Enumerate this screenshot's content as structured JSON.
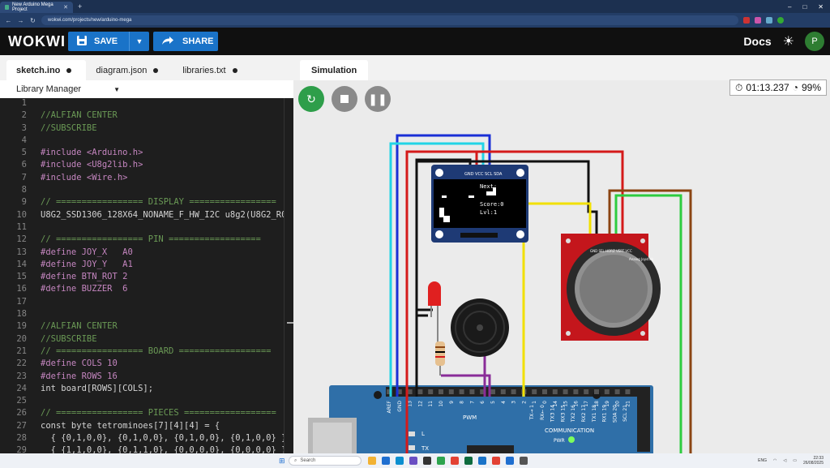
{
  "browser": {
    "tab_title": "New Arduino Mega Project",
    "url": "wokwi.com/projects/new/arduino-mega",
    "window_controls": [
      "–",
      "□",
      "✕"
    ]
  },
  "header": {
    "logo": "WOKWI",
    "save_label": "SAVE",
    "share_label": "SHARE",
    "docs_label": "Docs",
    "avatar_initial": "P",
    "accent": "#1a73c8"
  },
  "editor": {
    "tabs": [
      {
        "label": "sketch.ino"
      },
      {
        "label": "diagram.json"
      },
      {
        "label": "libraries.txt"
      }
    ],
    "library_manager_label": "Library Manager",
    "lines": [
      {
        "n": "1",
        "t": ""
      },
      {
        "n": "2",
        "t": "//ALFIAN CENTER",
        "c": "c-com"
      },
      {
        "n": "3",
        "t": "//SUBSCRIBE",
        "c": "c-com"
      },
      {
        "n": "4",
        "t": ""
      },
      {
        "n": "5",
        "t": "#include <Arduino.h>",
        "c": "c-def"
      },
      {
        "n": "6",
        "t": "#include <U8g2lib.h>",
        "c": "c-def"
      },
      {
        "n": "7",
        "t": "#include <Wire.h>",
        "c": "c-def"
      },
      {
        "n": "8",
        "t": ""
      },
      {
        "n": "9",
        "t": "// ================= DISPLAY =================",
        "c": "c-com"
      },
      {
        "n": "10",
        "t": "U8G2_SSD1306_128X64_NONAME_F_HW_I2C u8g2(U8G2_R0"
      },
      {
        "n": "11",
        "t": ""
      },
      {
        "n": "12",
        "t": "// ================= PIN ==================",
        "c": "c-com"
      },
      {
        "n": "13",
        "t": "#define JOY_X   A0",
        "c": "c-def"
      },
      {
        "n": "14",
        "t": "#define JOY_Y   A1",
        "c": "c-def"
      },
      {
        "n": "15",
        "t": "#define BTN_ROT 2",
        "c": "c-def"
      },
      {
        "n": "16",
        "t": "#define BUZZER  6",
        "c": "c-def"
      },
      {
        "n": "17",
        "t": ""
      },
      {
        "n": "18",
        "t": ""
      },
      {
        "n": "19",
        "t": "//ALFIAN CENTER",
        "c": "c-com"
      },
      {
        "n": "20",
        "t": "//SUBSCRIBE",
        "c": "c-com"
      },
      {
        "n": "21",
        "t": "// ================= BOARD ==================",
        "c": "c-com"
      },
      {
        "n": "22",
        "t": "#define COLS 10",
        "c": "c-def"
      },
      {
        "n": "23",
        "t": "#define ROWS 16",
        "c": "c-def"
      },
      {
        "n": "24",
        "t": "int board[ROWS][COLS];"
      },
      {
        "n": "25",
        "t": ""
      },
      {
        "n": "26",
        "t": "// ================= PIECES ==================",
        "c": "c-com"
      },
      {
        "n": "27",
        "t": "const byte tetrominoes[7][4][4] = {"
      },
      {
        "n": "28",
        "t": "  { {0,1,0,0}, {0,1,0,0}, {0,1,0,0}, {0,1,0,0} },"
      },
      {
        "n": "29",
        "t": "  { {1,1,0,0}, {0,1,1,0}, {0,0,0,0}, {0,0,0,0} },"
      }
    ]
  },
  "simulation": {
    "tab_label": "Simulation",
    "elapsed": "01:13.237",
    "speed": "99%",
    "oled": {
      "pins": "GND VCC SCL SDA",
      "next_label": "Next:",
      "score": "Score:0",
      "level": "Lvl:1"
    },
    "joystick_label": "Analog Joystick",
    "joystick_pins": "GND SEL HORZ VERT VCC",
    "mega": {
      "pwm_label": "PWM",
      "comm_label": "COMMUNICATION",
      "pwr_label": "PWR",
      "l_label": "L",
      "tx_label": "TX",
      "header_pins": [
        "AREF",
        "GND",
        "13",
        "12",
        "11",
        "10",
        "9",
        "8",
        "7",
        "6",
        "5",
        "4",
        "3",
        "2",
        "1",
        "0",
        "14",
        "15",
        "16",
        "17",
        "18",
        "19",
        "20",
        "21"
      ],
      "serial_labels": [
        "TX→ 1",
        "RX← 0",
        "TX3 14",
        "RX3 15",
        "TX2 16",
        "RX2 17",
        "TX1 18",
        "RX1 19",
        "SDA 20",
        "SCL 21"
      ]
    }
  },
  "taskbar": {
    "search_placeholder": "Search",
    "lang": "ENG",
    "time": "22:33",
    "date": "26/08/2025"
  }
}
